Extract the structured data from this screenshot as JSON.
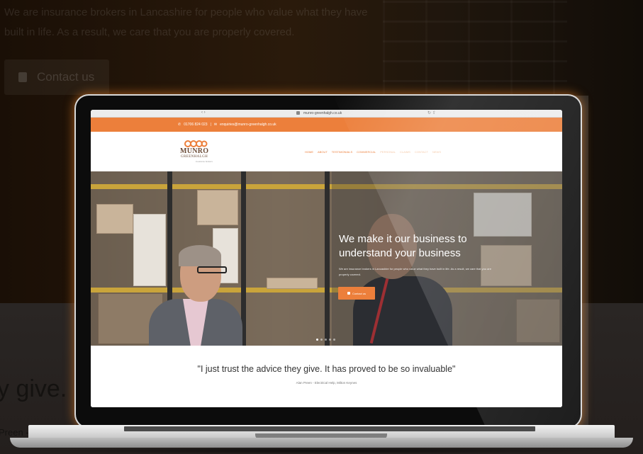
{
  "background": {
    "intro_text": "We are insurance brokers in Lancashire for people who value what they have built in life. As a result, we care that you are properly covered.",
    "contact_label": "Contact us",
    "quote_fragment": "y give. I",
    "cite_fragment": "Preen - El"
  },
  "browser": {
    "url": "munro-greenhalgh.co.uk",
    "back_symbol": "‹ ›",
    "reload_symbol": "↻ ⇧"
  },
  "site": {
    "topbar": {
      "phone": "01706 824 023",
      "separator": "|",
      "email": "enquiries@munro-greenhalgh.co.uk"
    },
    "logo": {
      "name": "MUNRO",
      "sub": "GREENHALGH",
      "tag": "insurance brokers"
    },
    "nav": [
      "HOME",
      "ABOUT",
      "TESTIMONIALS",
      "COMMERCIAL",
      "PERSONAL",
      "CLAIMS",
      "CONTACT",
      "NEWS"
    ],
    "hero": {
      "title": "We make it our business to understand your business",
      "subtitle": "We are insurance brokers in Lancashire for people who value what they have built in life. As a result, we care that you are properly covered.",
      "button_label": "Contact us"
    },
    "testimonial": {
      "quote": "\"I just trust the advice they give. It has proved to be so invaluable\"",
      "author": "Alan Preen - Electrical Help, Milton Keynes"
    }
  },
  "colors": {
    "accent": "#ec7f3b",
    "brand_brown": "#6a4a36"
  },
  "icons": [
    "phone-icon",
    "email-icon",
    "lock-icon",
    "logo-mark-icon"
  ]
}
